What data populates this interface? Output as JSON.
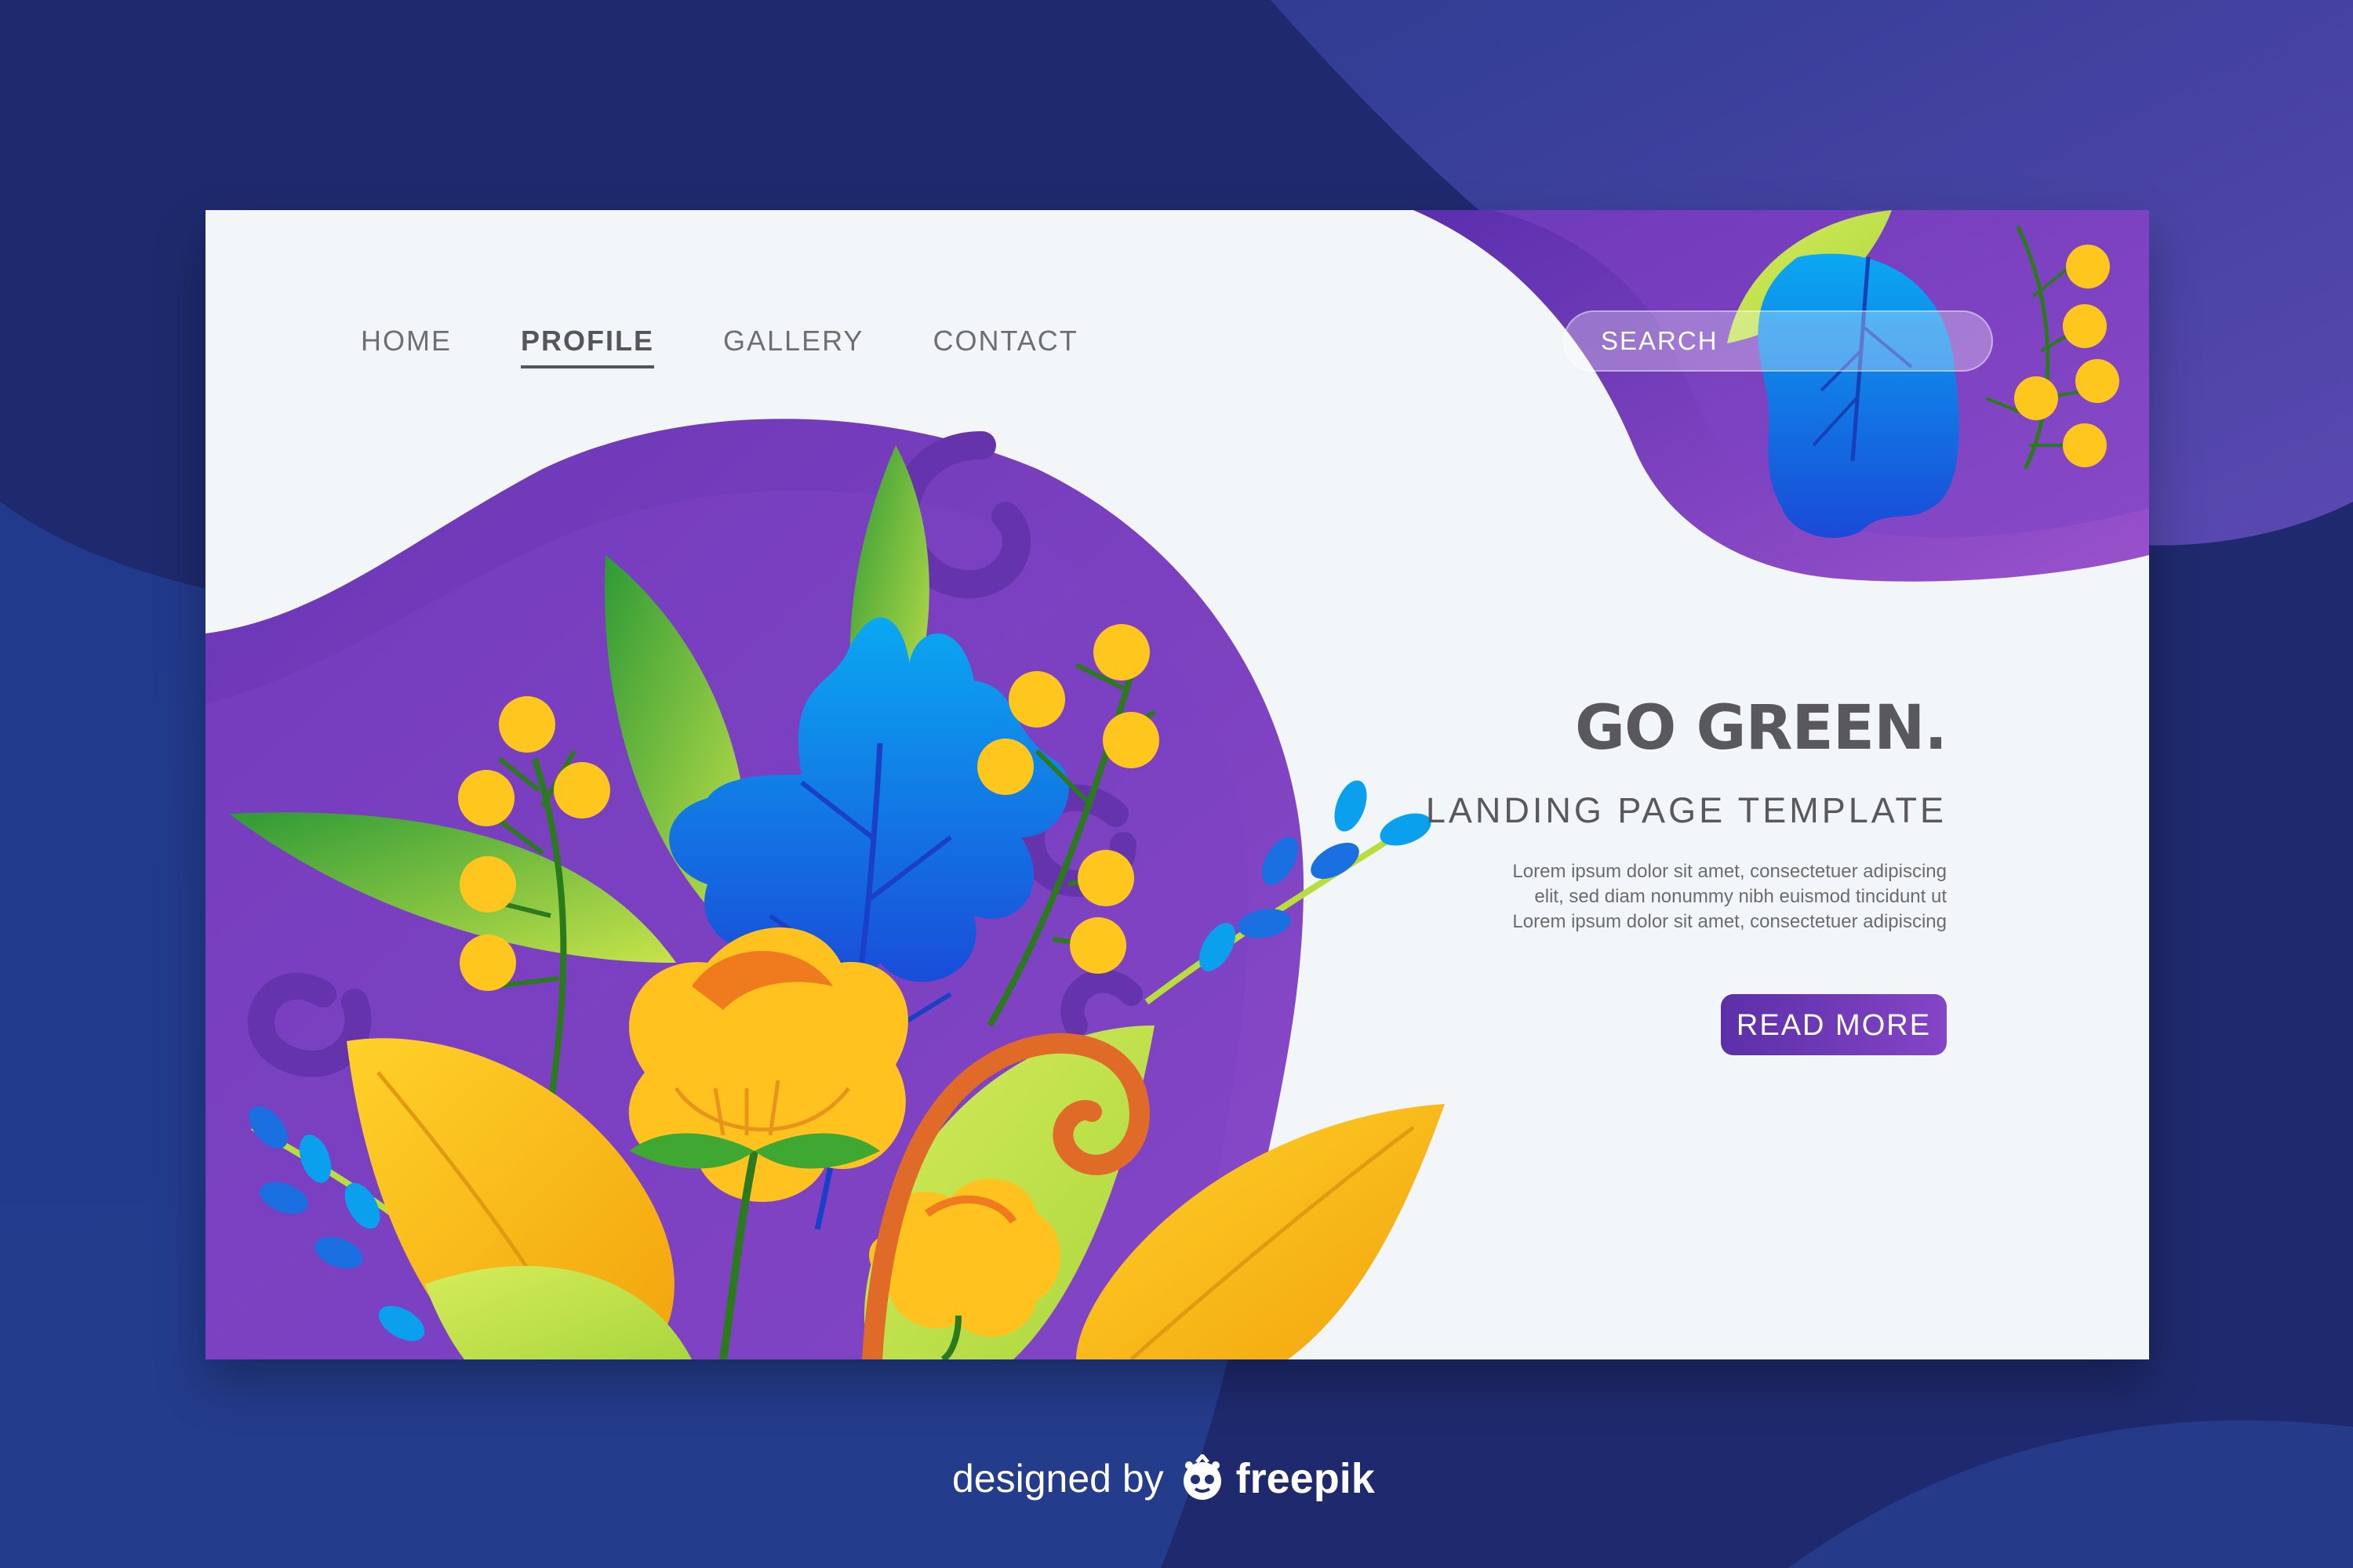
{
  "nav": {
    "items": [
      {
        "label": "HOME",
        "active": false
      },
      {
        "label": "PROFILE",
        "active": true
      },
      {
        "label": "GALLERY",
        "active": false
      },
      {
        "label": "CONTACT",
        "active": false
      }
    ]
  },
  "search": {
    "placeholder": "SEARCH"
  },
  "hero": {
    "title": "GO GREEN.",
    "subtitle": "LANDING PAGE TEMPLATE",
    "body": [
      "Lorem ipsum dolor sit amet, consectetuer adipiscing",
      "elit, sed diam nonummy nibh euismod tincidunt ut",
      "Lorem ipsum dolor sit amet, consectetuer adipiscing"
    ],
    "button_label": "READ MORE"
  },
  "credit": {
    "prefix": "designed by",
    "brand": "freepik"
  },
  "colors": {
    "background": "#1f2a6e",
    "card": "#f3f6f8",
    "purple": "#7a3fc0",
    "button": "#6b36b4",
    "text_dark": "#58585e"
  },
  "icons": {
    "logo": "freepik-logo-icon",
    "decor": "floral-illustration"
  }
}
